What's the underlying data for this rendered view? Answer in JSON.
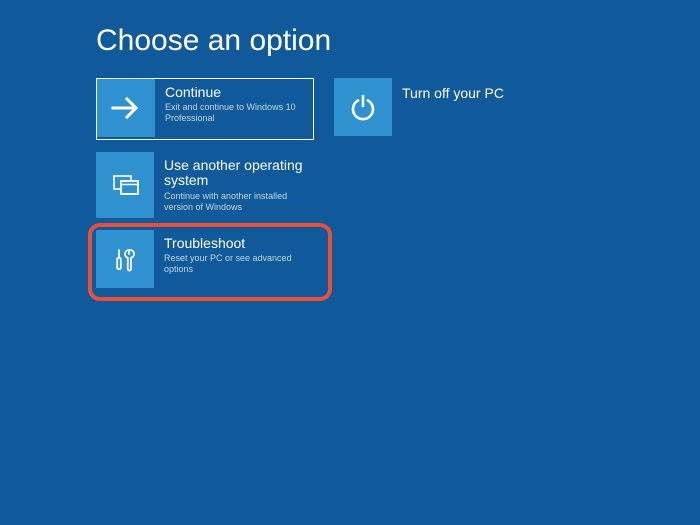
{
  "title": "Choose an option",
  "tiles": {
    "continue": {
      "label": "Continue",
      "desc": "Exit and continue to Windows 10 Professional"
    },
    "useAnother": {
      "label": "Use another operating system",
      "desc": "Continue with another installed version of Windows"
    },
    "troubleshoot": {
      "label": "Troubleshoot",
      "desc": "Reset your PC or see advanced options"
    },
    "turnOff": {
      "label": "Turn off your PC"
    }
  },
  "colors": {
    "background": "#105a9c",
    "tileIcon": "#2f91d0",
    "highlight": "#e8503a"
  }
}
